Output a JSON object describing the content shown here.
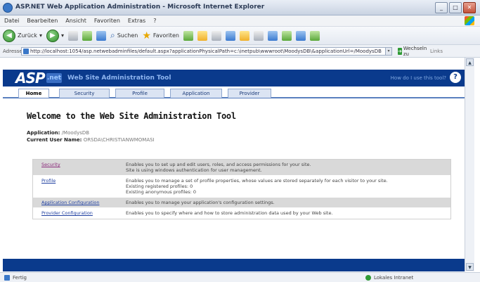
{
  "window": {
    "title": "ASP.NET Web Application Administration - Microsoft Internet Explorer",
    "buttons": [
      "_",
      "□",
      "✕"
    ]
  },
  "menubar": {
    "items": [
      "Datei",
      "Bearbeiten",
      "Ansicht",
      "Favoriten",
      "Extras",
      "?"
    ]
  },
  "toolbar": {
    "back_label": "Zurück",
    "search_label": "Suchen",
    "favorites_label": "Favoriten"
  },
  "address": {
    "label": "Adresse",
    "url": "http://localhost:1054/asp.netwebadminfiles/default.aspx?applicationPhysicalPath=c:\\inetpub\\wwwroot\\MoodysDB\\&applicationUrl=/MoodysDB",
    "go_label": "Wechseln zu",
    "links_label": "Links"
  },
  "asp_header": {
    "logo": "ASP",
    "net": ".net",
    "title": "Web Site Administration Tool",
    "help_link": "How do I use this tool?",
    "help_icon": "?"
  },
  "tabs": [
    {
      "label": "Home",
      "active": true
    },
    {
      "label": "Security",
      "active": false
    },
    {
      "label": "Profile",
      "active": false
    },
    {
      "label": "Application",
      "active": false
    },
    {
      "label": "Provider",
      "active": false
    }
  ],
  "content": {
    "heading": "Welcome to the Web Site Administration Tool",
    "application_label": "Application:",
    "application_value": "/MoodysDB",
    "user_label": "Current User Name:",
    "user_value": "ORSDA\\CHRISTIANWMOMASI",
    "sections": [
      {
        "link": "Security",
        "visited": true,
        "lines": [
          "Enables you to set up and edit users, roles, and access permissions for your site.",
          "Site is using windows authentication for user management."
        ],
        "shade": true
      },
      {
        "link": "Profile",
        "visited": false,
        "lines": [
          "Enables you to manage a set of profile properties, whose values are stored separately for each visitor to your site.",
          "Existing registered profiles: 0",
          "Existing anonymous profiles: 0"
        ],
        "shade": false
      },
      {
        "link": "Application Configuration",
        "visited": false,
        "lines": [
          "Enables you to manage your application's configuration settings."
        ],
        "shade": true
      },
      {
        "link": "Provider Configuration",
        "visited": false,
        "lines": [
          "Enables you to specify where and how to store administration data used by your Web site."
        ],
        "shade": false
      }
    ]
  },
  "statusbar": {
    "left": "Fertig",
    "right": "Lokales Intranet"
  }
}
